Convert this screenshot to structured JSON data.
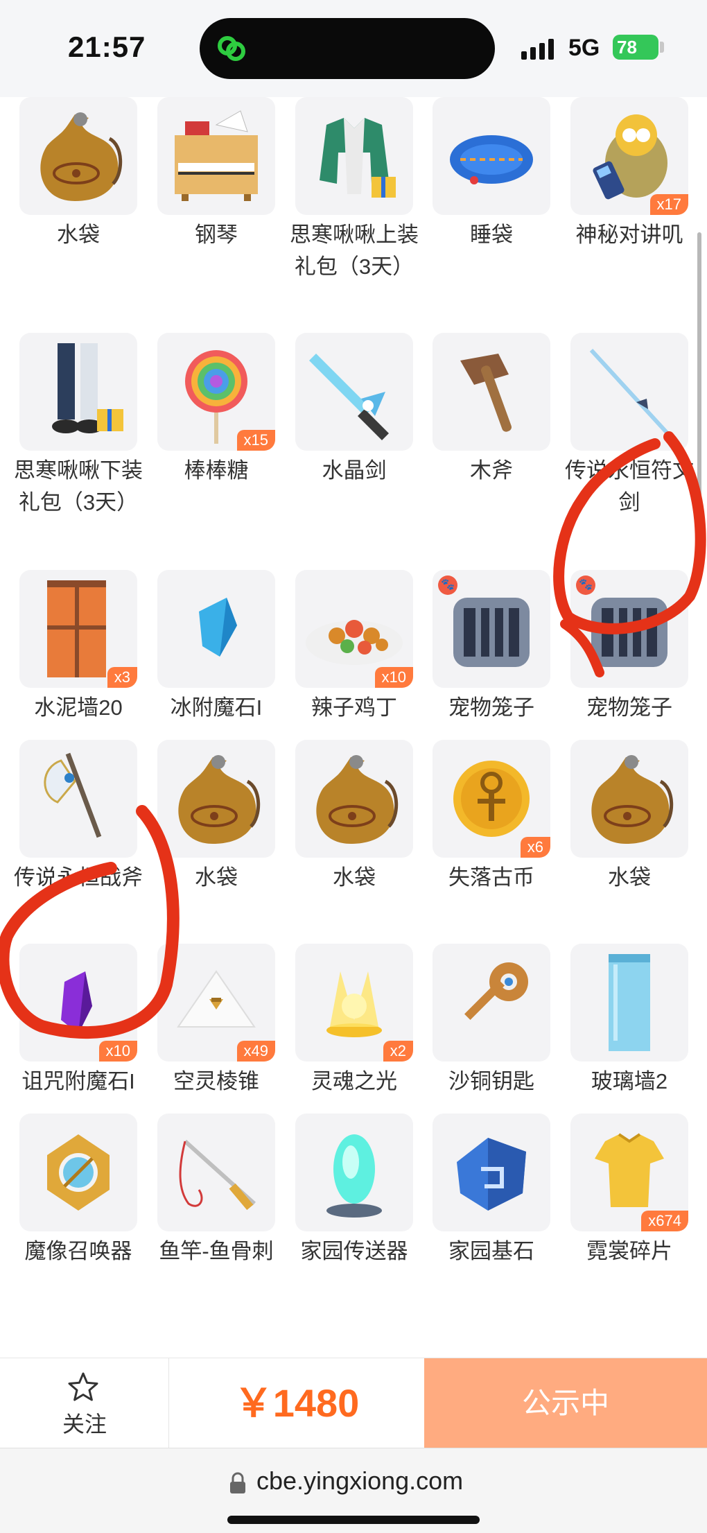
{
  "status_bar": {
    "time": "21:57",
    "network": "5G",
    "battery": "78",
    "battery_color": "#34c759"
  },
  "items": [
    {
      "name": "水袋",
      "qty": "",
      "icon": "water-bag"
    },
    {
      "name": "钢琴",
      "qty": "",
      "icon": "piano"
    },
    {
      "name": "思寒啾啾上装礼包（3天）",
      "qty": "",
      "icon": "outfit-top"
    },
    {
      "name": "睡袋",
      "qty": "",
      "icon": "sleeping-bag"
    },
    {
      "name": "神秘对讲叽",
      "qty": "x17",
      "icon": "walkie-talkie"
    },
    {
      "name": "思寒啾啾下装礼包（3天）",
      "qty": "",
      "icon": "outfit-bottom"
    },
    {
      "name": "棒棒糖",
      "qty": "x15",
      "icon": "lollipop"
    },
    {
      "name": "水晶剑",
      "qty": "",
      "icon": "crystal-sword"
    },
    {
      "name": "木斧",
      "qty": "",
      "icon": "wood-axe"
    },
    {
      "name": "传说永恒符文剑",
      "qty": "",
      "icon": "rune-sword"
    },
    {
      "name": "水泥墙20",
      "qty": "x3",
      "icon": "cement-wall"
    },
    {
      "name": "冰附魔石I",
      "qty": "",
      "icon": "ice-stone"
    },
    {
      "name": "辣子鸡丁",
      "qty": "x10",
      "icon": "spicy-chicken"
    },
    {
      "name": "宠物笼子",
      "qty": "",
      "icon": "pet-cage"
    },
    {
      "name": "宠物笼子",
      "qty": "",
      "icon": "pet-cage"
    },
    {
      "name": "传说永恒战斧",
      "qty": "",
      "icon": "battle-axe"
    },
    {
      "name": "水袋",
      "qty": "",
      "icon": "water-bag"
    },
    {
      "name": "水袋",
      "qty": "",
      "icon": "water-bag"
    },
    {
      "name": "失落古币",
      "qty": "x6",
      "icon": "ancient-coin"
    },
    {
      "name": "水袋",
      "qty": "",
      "icon": "water-bag"
    },
    {
      "name": "诅咒附魔石I",
      "qty": "x10",
      "icon": "curse-stone"
    },
    {
      "name": "空灵棱锥",
      "qty": "x49",
      "icon": "pyramid"
    },
    {
      "name": "灵魂之光",
      "qty": "x2",
      "icon": "soul-light"
    },
    {
      "name": "沙铜钥匙",
      "qty": "",
      "icon": "bronze-key"
    },
    {
      "name": "玻璃墙2",
      "qty": "",
      "icon": "glass-wall"
    },
    {
      "name": "魔像召唤器",
      "qty": "",
      "icon": "golem-summoner"
    },
    {
      "name": "鱼竿-鱼骨刺",
      "qty": "",
      "icon": "fishing-rod"
    },
    {
      "name": "家园传送器",
      "qty": "",
      "icon": "home-teleporter"
    },
    {
      "name": "家园基石",
      "qty": "",
      "icon": "home-cornerstone"
    },
    {
      "name": "霓裳碎片",
      "qty": "x674",
      "icon": "tshirt-shard"
    }
  ],
  "bottom_bar": {
    "follow_label": "关注",
    "price": "￥1480",
    "cta_label": "公示中",
    "price_color": "#ff6a1f",
    "cta_color": "#ffab80"
  },
  "url_bar": {
    "url": "cbe.yingxiong.com"
  }
}
